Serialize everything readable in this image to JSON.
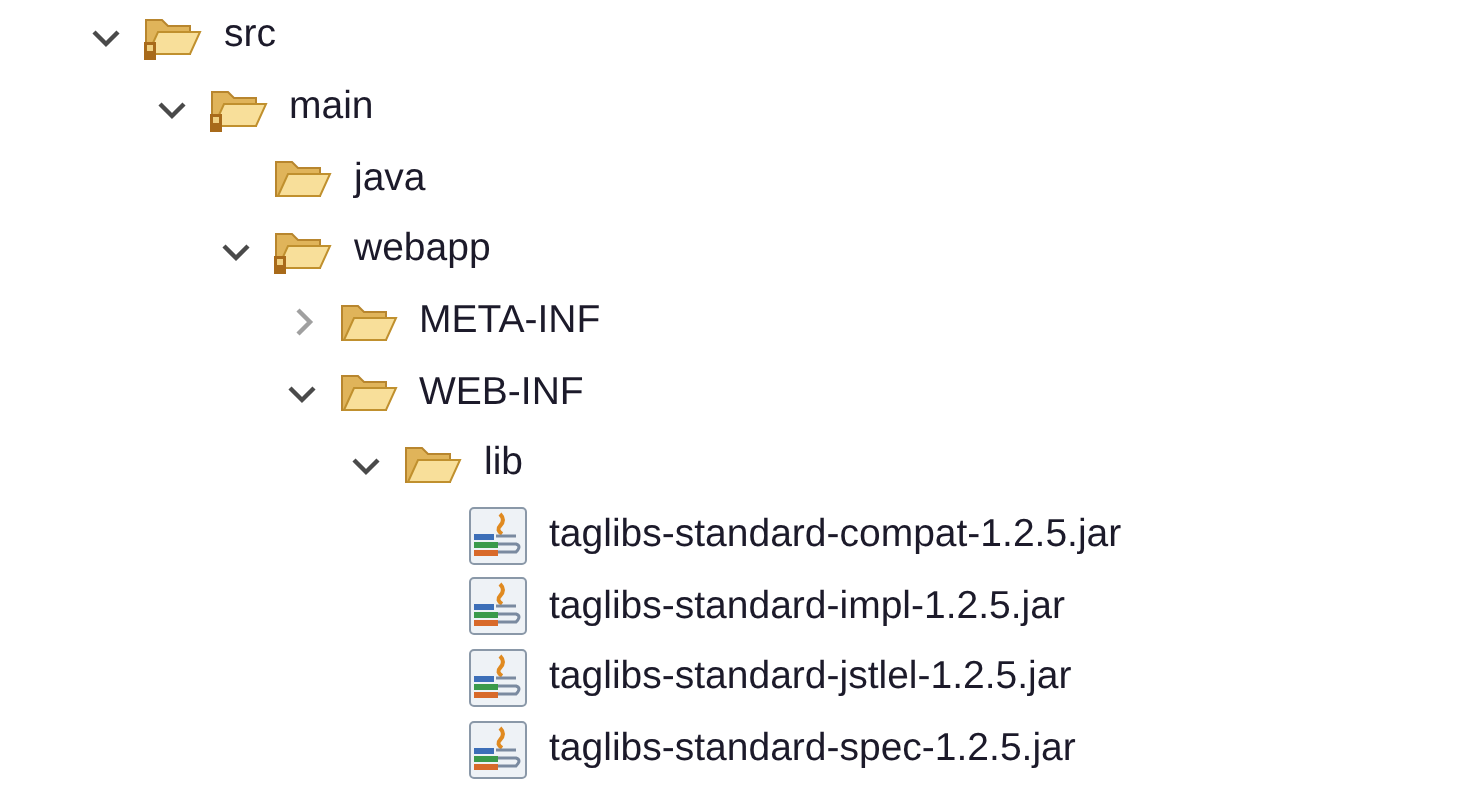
{
  "tree": [
    {
      "label": "src",
      "kind": "source-folder",
      "expanded": true,
      "children": [
        {
          "label": "main",
          "kind": "source-folder",
          "expanded": true,
          "children": [
            {
              "label": "java",
              "kind": "folder"
            },
            {
              "label": "webapp",
              "kind": "source-folder",
              "expanded": true,
              "children": [
                {
                  "label": "META-INF",
                  "kind": "folder",
                  "expanded": false
                },
                {
                  "label": "WEB-INF",
                  "kind": "folder",
                  "expanded": true,
                  "children": [
                    {
                      "label": "lib",
                      "kind": "folder",
                      "expanded": true,
                      "children": [
                        {
                          "label": "taglibs-standard-compat-1.2.5.jar",
                          "kind": "jar"
                        },
                        {
                          "label": "taglibs-standard-impl-1.2.5.jar",
                          "kind": "jar"
                        },
                        {
                          "label": "taglibs-standard-jstlel-1.2.5.jar",
                          "kind": "jar"
                        },
                        {
                          "label": "taglibs-standard-spec-1.2.5.jar",
                          "kind": "jar"
                        }
                      ]
                    }
                  ]
                }
              ]
            }
          ]
        }
      ]
    }
  ]
}
